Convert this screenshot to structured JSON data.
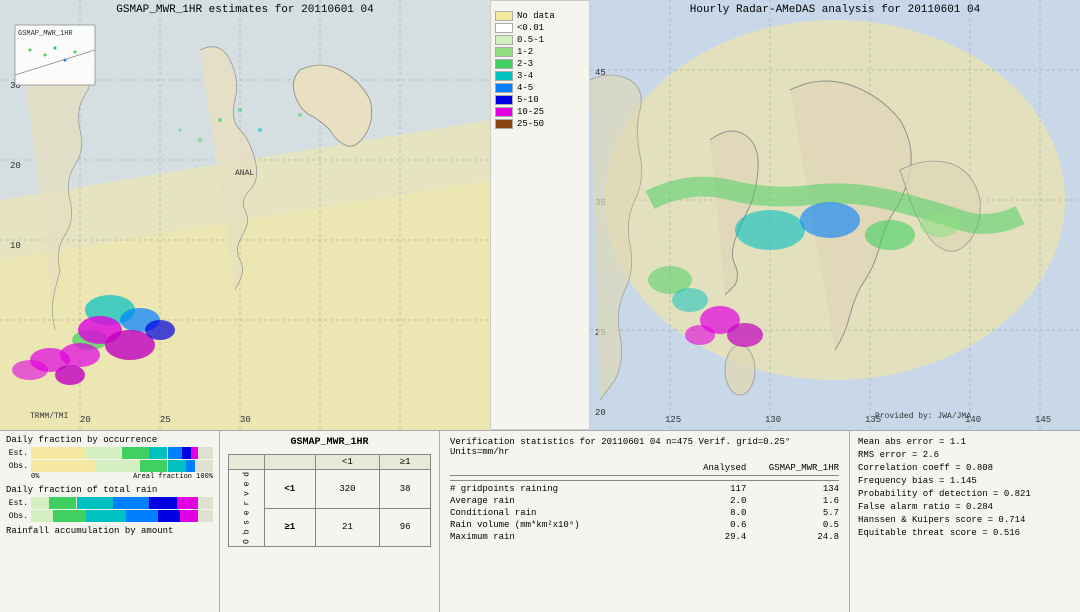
{
  "leftMap": {
    "title": "GSMAP_MWR_1HR estimates for 20110601 04",
    "sublabel": "TRMM/TMI",
    "analLabel": "ANAL"
  },
  "rightMap": {
    "title": "Hourly Radar-AMeDAS analysis for 20110601 04",
    "attribution": "Provided by: JWA/JMA"
  },
  "legend": {
    "title": "",
    "items": [
      {
        "label": "No data",
        "color": "#f5f0d0"
      },
      {
        "label": "<0.01",
        "color": "#ffffff"
      },
      {
        "label": "0.5-1",
        "color": "#d4f0c0"
      },
      {
        "label": "1-2",
        "color": "#90e080"
      },
      {
        "label": "2-3",
        "color": "#40d060"
      },
      {
        "label": "3-4",
        "color": "#00c0c0"
      },
      {
        "label": "4-5",
        "color": "#0080ff"
      },
      {
        "label": "5-10",
        "color": "#0000e0"
      },
      {
        "label": "10-25",
        "color": "#e000e0"
      },
      {
        "label": "25-50",
        "color": "#8b4513"
      }
    ]
  },
  "barCharts": {
    "occurrenceTitle": "Daily fraction by occurrence",
    "totalRainTitle": "Daily fraction of total rain",
    "amountTitle": "Rainfall accumulation by amount",
    "estLabel": "Est.",
    "obsLabel": "Obs.",
    "axisLeft": "0%",
    "axisRight": "Areal fraction 100%"
  },
  "matrix": {
    "title": "GSMAP_MWR_1HR",
    "colHeaders": [
      "<1",
      "≥1"
    ],
    "rowHeaders": [
      "<1",
      "≥1"
    ],
    "obsLabel": "O\nb\ns\ne\nr\nv\ne\nd",
    "values": [
      [
        "320",
        "38"
      ],
      [
        "21",
        "96"
      ]
    ]
  },
  "stats": {
    "title": "Verification statistics for 20110601 04  n=475  Verif. grid=0.25°  Units=mm/hr",
    "headers": [
      "Analysed",
      "GSMAP_MWR_1HR"
    ],
    "rows": [
      {
        "label": "# gridpoints raining",
        "analysed": "117",
        "gsmap": "134"
      },
      {
        "label": "Average rain",
        "analysed": "2.0",
        "gsmap": "1.6"
      },
      {
        "label": "Conditional rain",
        "analysed": "8.0",
        "gsmap": "5.7"
      },
      {
        "label": "Rain volume (mm*km²x10⁶)",
        "analysed": "0.6",
        "gsmap": "0.5"
      },
      {
        "label": "Maximum rain",
        "analysed": "29.4",
        "gsmap": "24.8"
      }
    ]
  },
  "metrics": {
    "lines": [
      "Mean abs error = 1.1",
      "RMS error = 2.6",
      "Correlation coeff = 0.808",
      "Frequency bias = 1.145",
      "Probability of detection = 0.821",
      "False alarm ratio = 0.284",
      "Hanssen & Kuipers score = 0.714",
      "Equitable threat score = 0.516"
    ]
  }
}
